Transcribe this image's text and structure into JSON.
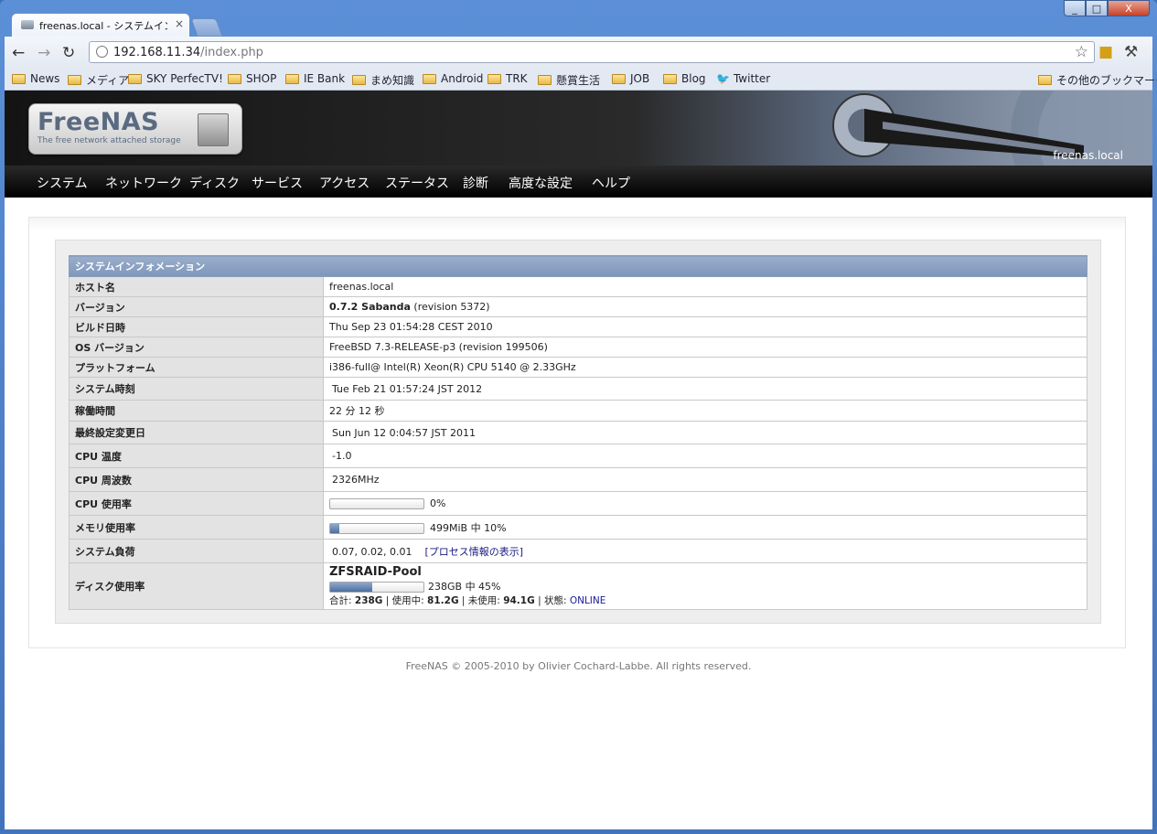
{
  "browser": {
    "tab_title": "freenas.local - システムインフォ",
    "tab_close": "×",
    "url_host": "192.168.11.34",
    "url_path": "/index.php",
    "window_buttons": [
      "_",
      "□",
      "X"
    ]
  },
  "bookmarks": {
    "items": [
      "News",
      "メディア",
      "SKY PerfecTV!",
      "SHOP",
      "IE Bank",
      "まめ知識",
      "Android",
      "TRK",
      "懸賞生活",
      "JOB",
      "Blog",
      "Twitter"
    ],
    "other": "その他のブックマーク"
  },
  "header": {
    "logo_name": "FreeNAS",
    "logo_tagline": "The free network attached storage",
    "hostname": "freenas.local"
  },
  "menu": [
    "システム",
    "ネットワーク",
    "ディスク",
    "サービス",
    "アクセス",
    "ステータス",
    "診断",
    "高度な設定",
    "ヘルプ"
  ],
  "sysinfo": {
    "caption": "システムインフォメーション",
    "rows": {
      "hostname": {
        "label": "ホスト名",
        "value": "freenas.local"
      },
      "version": {
        "label": "バージョン",
        "value_bold": "0.7.2 Sabanda",
        "value": "(revision 5372)"
      },
      "build": {
        "label": "ビルド日時",
        "value": "Thu Sep 23 01:54:28 CEST 2010"
      },
      "os": {
        "label": "OS バージョン",
        "value": "FreeBSD 7.3-RELEASE-p3 (revision 199506)"
      },
      "platform": {
        "label": "プラットフォーム",
        "value": "i386-full@ Intel(R) Xeon(R) CPU 5140 @ 2.33GHz"
      },
      "time": {
        "label": "システム時刻",
        "value": "Tue Feb 21 01:57:24 JST 2012"
      },
      "uptime": {
        "label": "稼働時間",
        "value": "22 分 12 秒"
      },
      "lastchange": {
        "label": "最終設定変更日",
        "value": "Sun Jun 12 0:04:57 JST 2011"
      },
      "cputemp": {
        "label": "CPU 温度",
        "value": "-1.0"
      },
      "cpufreq": {
        "label": "CPU 周波数",
        "value": "2326MHz"
      },
      "cpuusage": {
        "label": "CPU 使用率",
        "value": "0%",
        "percent": 0
      },
      "memusage": {
        "label": "メモリ使用率",
        "value": "499MiB 中 10%",
        "percent": 10
      },
      "load": {
        "label": "システム負荷",
        "value": "0.07, 0.02, 0.01",
        "link": "[プロセス情報の表示]"
      },
      "disk": {
        "label": "ディスク使用率",
        "pool": "ZFSRAID-Pool",
        "value": "238GB 中  45%",
        "percent": 45,
        "total_label": "合計:",
        "total": "238G",
        "used_label": "| 使用中:",
        "used": "81.2G",
        "free_label": "| 未使用:",
        "free": "94.1G",
        "state_label": "| 状態:",
        "state": "ONLINE"
      }
    }
  },
  "footer": "FreeNAS © 2005-2010 by Olivier Cochard-Labbe. All rights reserved.",
  "colors": {
    "caption_bg": "#8aa0c2",
    "bar_fill": "#5b7bab",
    "menu_bg": "#111111"
  }
}
